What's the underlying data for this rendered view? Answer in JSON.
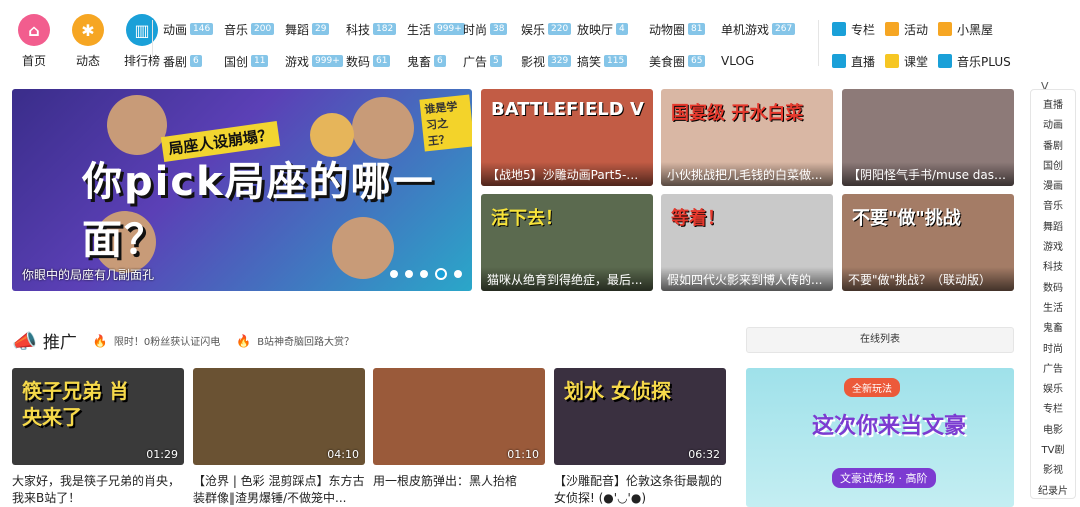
{
  "quick_nav": [
    {
      "label": "首页",
      "icon": "home-icon",
      "color": "#f25d8e",
      "glyph": "⌂"
    },
    {
      "label": "动态",
      "icon": "pinwheel-icon",
      "color": "#f6a623",
      "glyph": "✱"
    },
    {
      "label": "排行榜",
      "icon": "rank-chart-icon",
      "color": "#1aa0d8",
      "glyph": "▥"
    }
  ],
  "categories": [
    {
      "label": "动画",
      "count": "146"
    },
    {
      "label": "音乐",
      "count": "200"
    },
    {
      "label": "舞蹈",
      "count": "29"
    },
    {
      "label": "科技",
      "count": "182"
    },
    {
      "label": "生活",
      "count": "999+"
    },
    {
      "label": "时尚",
      "count": "38"
    },
    {
      "label": "娱乐",
      "count": "220"
    },
    {
      "label": "放映厅",
      "count": "4"
    },
    {
      "label": "动物圈",
      "count": "81"
    },
    {
      "label": "单机游戏",
      "count": "267"
    },
    {
      "label": "",
      "count": ""
    },
    {
      "label": "番剧",
      "count": "6"
    },
    {
      "label": "国创",
      "count": "11"
    },
    {
      "label": "游戏",
      "count": "999+"
    },
    {
      "label": "数码",
      "count": "61"
    },
    {
      "label": "鬼畜",
      "count": "6"
    },
    {
      "label": "广告",
      "count": "5"
    },
    {
      "label": "影视",
      "count": "329"
    },
    {
      "label": "搞笑",
      "count": "115"
    },
    {
      "label": "美食圈",
      "count": "65"
    },
    {
      "label": "VLOG",
      "count": ""
    },
    {
      "label": "",
      "count": ""
    }
  ],
  "special_links": [
    {
      "label": "专栏",
      "icon": "column-icon",
      "color": "#1aa0d8"
    },
    {
      "label": "活动",
      "icon": "flag-icon",
      "color": "#f6a623"
    },
    {
      "label": "小黑屋",
      "icon": "blackroom-icon",
      "color": "#f6a623"
    },
    {
      "label": "直播",
      "icon": "live-icon",
      "color": "#1aa0d8"
    },
    {
      "label": "课堂",
      "icon": "classroom-icon",
      "color": "#f6c623"
    },
    {
      "label": "音乐PLUS",
      "icon": "music-plus-icon",
      "color": "#1aa0d8"
    }
  ],
  "banner": {
    "headline": "你pick局座的哪一面？",
    "subline": "局座人设崩塌？",
    "tag": "谁是学习之王？",
    "caption": "你眼中的局座有几副面孔"
  },
  "tiles": [
    {
      "caption": "【战地5】沙雕动画Part5-自...",
      "bg": "#c25c45",
      "big": "BATTLEFIELD V",
      "bigColor": "#ffffff"
    },
    {
      "caption": "小伙挑战把几毛钱的白菜做...",
      "bg": "#d9b7a4",
      "big": "国宴级 开水白菜",
      "bigColor": "#e63a2e"
    },
    {
      "caption": "【阴阳怪气手书/muse dash...",
      "bg": "#8d7a78",
      "big": "",
      "bigColor": "#ffffff"
    },
    {
      "caption": "猫咪从绝育到得绝症，最后...",
      "bg": "#5b6a4f",
      "big": "活下去！",
      "bigColor": "#f7e33a"
    },
    {
      "caption": "假如四代火影来到博人传的...",
      "bg": "#c9c9c9",
      "big": "等着！",
      "bigColor": "#e63a2e"
    },
    {
      "caption": "不要\"做\"挑战？（联动版）",
      "bg": "#a47c66",
      "big": "不要\"做\"挑战",
      "bigColor": "#ffffff"
    }
  ],
  "sidenav": [
    "直播",
    "动画",
    "番剧",
    "国创",
    "漫画",
    "音乐",
    "舞蹈",
    "游戏",
    "科技",
    "数码",
    "生活",
    "鬼畜",
    "时尚",
    "广告",
    "娱乐",
    "专栏",
    "电影",
    "TV剧",
    "影视",
    "纪录片"
  ],
  "promo": {
    "title": "推广",
    "hot_items": [
      "限时！0粉丝获认证闪电",
      "B站神奇脑回路大赏？"
    ],
    "online_list": "在线列表",
    "cards": [
      {
        "title": "大家好，我是筷子兄弟的肖央，我来B站了！",
        "duration": "01:29",
        "bg": "#3a3a3a",
        "art": "筷子兄弟 肖央来了"
      },
      {
        "title": "【沧界 | 色彩 混剪踩点】东方古装群像‖渣男爆锤/不做笼中...",
        "duration": "04:10",
        "bg": "#6a5233",
        "art": ""
      },
      {
        "title": "用一根皮筋弹出：黑人抬棺",
        "duration": "01:10",
        "bg": "#9a5a3a",
        "art": ""
      },
      {
        "title": "【沙雕配音】伦敦这条街最靓的女侦探! (●'◡'●)",
        "duration": "06:32",
        "bg": "#3a3040",
        "art": "划水 女侦探"
      }
    ],
    "ad": {
      "badge": "全新玩法",
      "text": "这次你来当文豪",
      "sub": "文豪试炼场 · 高阶"
    }
  }
}
